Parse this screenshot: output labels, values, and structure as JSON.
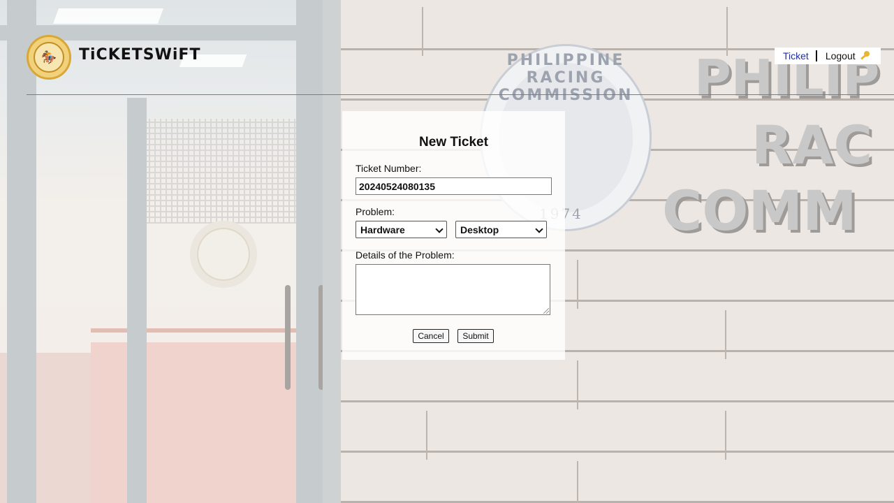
{
  "brand": {
    "name": "TiCKETSWiFT",
    "logo_icon": "racing-commission-seal"
  },
  "nav": {
    "ticket_label": "Ticket",
    "logout_label": "Logout",
    "logout_icon": "key-icon"
  },
  "background": {
    "seal_text": "PHILIPPINE RACING COMMISSION",
    "seal_year": "1974",
    "wall_lines": [
      "PHILIP",
      "RAC",
      "COMM"
    ]
  },
  "form": {
    "title": "New Ticket",
    "ticket_number_label": "Ticket Number:",
    "ticket_number_value": "20240524080135",
    "problem_label": "Problem:",
    "problem_category_selected": "Hardware",
    "problem_type_selected": "Desktop",
    "details_label": "Details of the Problem:",
    "details_value": "",
    "cancel_label": "Cancel",
    "submit_label": "Submit"
  },
  "colors": {
    "nav_link": "#1f2fa6",
    "logo_gold": "#d9a737"
  }
}
